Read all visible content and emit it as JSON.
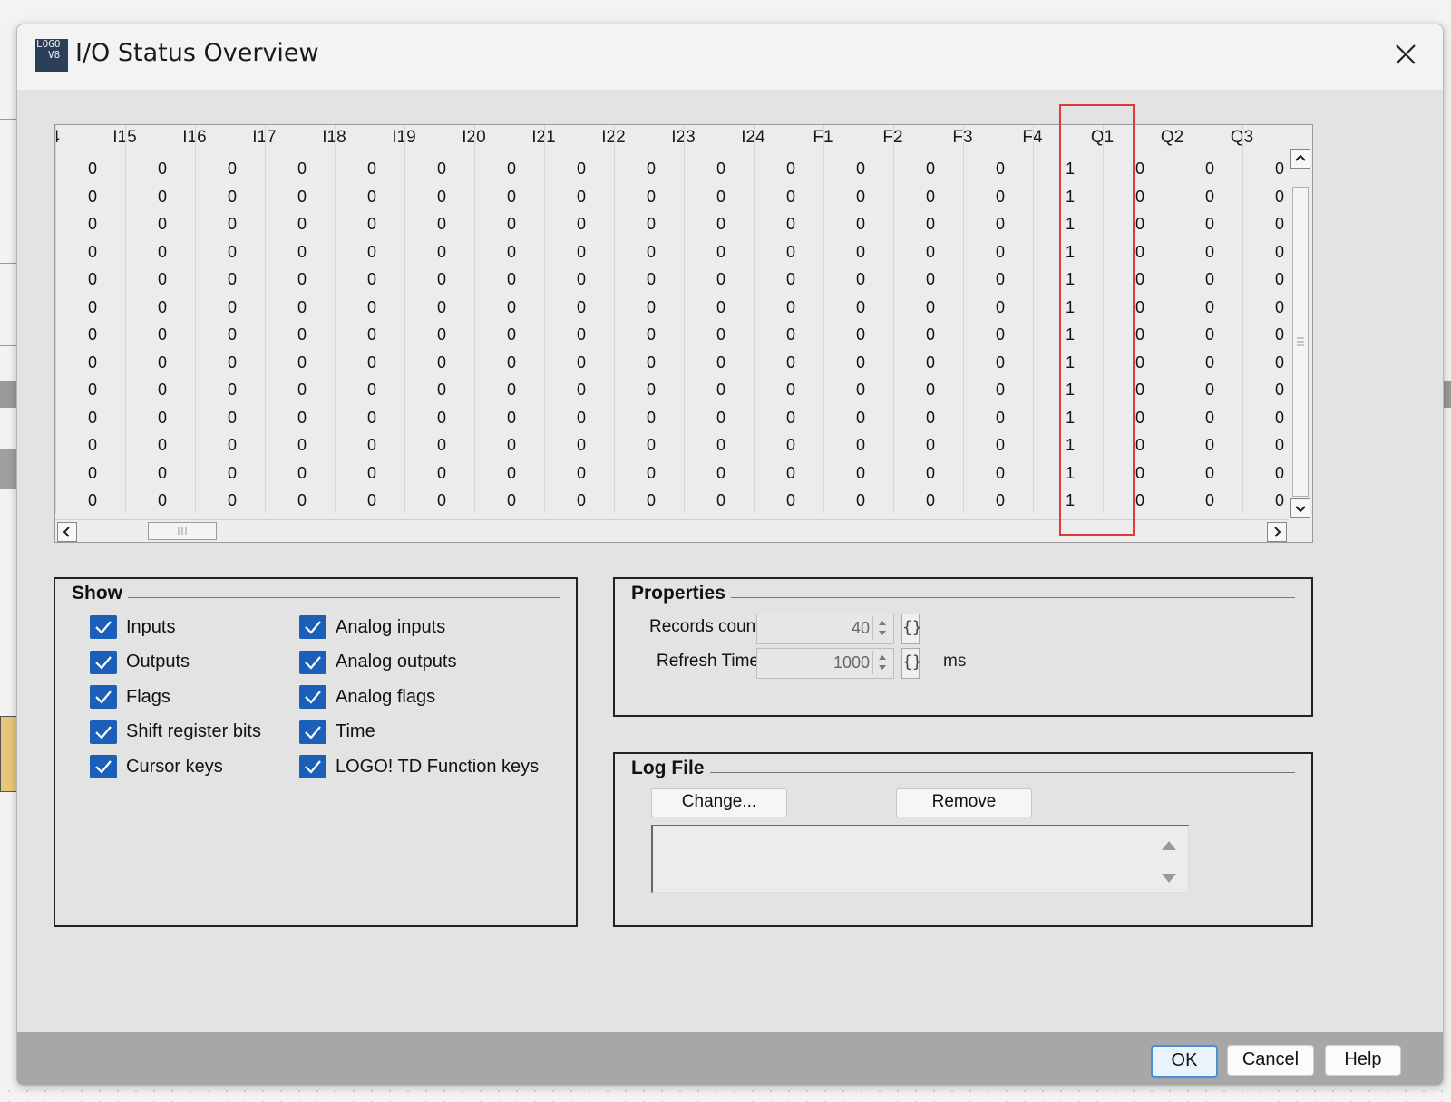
{
  "window": {
    "title": "I/O Status Overview",
    "icon_text_1": "LOGO",
    "icon_text_2": "V8"
  },
  "grid": {
    "columns": [
      "4",
      "I15",
      "I16",
      "I17",
      "I18",
      "I19",
      "I20",
      "I21",
      "I22",
      "I23",
      "I24",
      "F1",
      "F2",
      "F3",
      "F4",
      "Q1",
      "Q2",
      "Q3"
    ],
    "highlighted_column": "Q1",
    "rows": [
      [
        "0",
        "0",
        "0",
        "0",
        "0",
        "0",
        "0",
        "0",
        "0",
        "0",
        "0",
        "0",
        "0",
        "0",
        "1",
        "0",
        "0",
        "0"
      ],
      [
        "0",
        "0",
        "0",
        "0",
        "0",
        "0",
        "0",
        "0",
        "0",
        "0",
        "0",
        "0",
        "0",
        "0",
        "1",
        "0",
        "0",
        "0"
      ],
      [
        "0",
        "0",
        "0",
        "0",
        "0",
        "0",
        "0",
        "0",
        "0",
        "0",
        "0",
        "0",
        "0",
        "0",
        "1",
        "0",
        "0",
        "0"
      ],
      [
        "0",
        "0",
        "0",
        "0",
        "0",
        "0",
        "0",
        "0",
        "0",
        "0",
        "0",
        "0",
        "0",
        "0",
        "1",
        "0",
        "0",
        "0"
      ],
      [
        "0",
        "0",
        "0",
        "0",
        "0",
        "0",
        "0",
        "0",
        "0",
        "0",
        "0",
        "0",
        "0",
        "0",
        "1",
        "0",
        "0",
        "0"
      ],
      [
        "0",
        "0",
        "0",
        "0",
        "0",
        "0",
        "0",
        "0",
        "0",
        "0",
        "0",
        "0",
        "0",
        "0",
        "1",
        "0",
        "0",
        "0"
      ],
      [
        "0",
        "0",
        "0",
        "0",
        "0",
        "0",
        "0",
        "0",
        "0",
        "0",
        "0",
        "0",
        "0",
        "0",
        "1",
        "0",
        "0",
        "0"
      ],
      [
        "0",
        "0",
        "0",
        "0",
        "0",
        "0",
        "0",
        "0",
        "0",
        "0",
        "0",
        "0",
        "0",
        "0",
        "1",
        "0",
        "0",
        "0"
      ],
      [
        "0",
        "0",
        "0",
        "0",
        "0",
        "0",
        "0",
        "0",
        "0",
        "0",
        "0",
        "0",
        "0",
        "0",
        "1",
        "0",
        "0",
        "0"
      ],
      [
        "0",
        "0",
        "0",
        "0",
        "0",
        "0",
        "0",
        "0",
        "0",
        "0",
        "0",
        "0",
        "0",
        "0",
        "1",
        "0",
        "0",
        "0"
      ],
      [
        "0",
        "0",
        "0",
        "0",
        "0",
        "0",
        "0",
        "0",
        "0",
        "0",
        "0",
        "0",
        "0",
        "0",
        "1",
        "0",
        "0",
        "0"
      ],
      [
        "0",
        "0",
        "0",
        "0",
        "0",
        "0",
        "0",
        "0",
        "0",
        "0",
        "0",
        "0",
        "0",
        "0",
        "1",
        "0",
        "0",
        "0"
      ],
      [
        "0",
        "0",
        "0",
        "0",
        "0",
        "0",
        "0",
        "0",
        "0",
        "0",
        "0",
        "0",
        "0",
        "0",
        "1",
        "0",
        "0",
        "0"
      ]
    ]
  },
  "show": {
    "title": "Show",
    "left": [
      {
        "label": "Inputs",
        "checked": true
      },
      {
        "label": "Outputs",
        "checked": true
      },
      {
        "label": "Flags",
        "checked": true
      },
      {
        "label": "Shift register bits",
        "checked": true
      },
      {
        "label": "Cursor keys",
        "checked": true
      }
    ],
    "right": [
      {
        "label": "Analog inputs",
        "checked": true
      },
      {
        "label": "Analog outputs",
        "checked": true
      },
      {
        "label": "Analog flags",
        "checked": true
      },
      {
        "label": "Time",
        "checked": true
      },
      {
        "label": "LOGO! TD Function keys",
        "checked": true
      }
    ]
  },
  "properties": {
    "title": "Properties",
    "records_label": "Records count:",
    "records_value": "40",
    "refresh_label": "Refresh Time:",
    "refresh_value": "1000",
    "bracket_glyph": "{}",
    "refresh_unit": "ms"
  },
  "log_file": {
    "title": "Log File",
    "change_label": "Change...",
    "remove_label": "Remove"
  },
  "footer": {
    "ok": "OK",
    "cancel": "Cancel",
    "help": "Help"
  },
  "colors": {
    "checkbox": "#1c5fb8",
    "highlight": "#e03a3a",
    "footer": "#a7a7a7"
  }
}
